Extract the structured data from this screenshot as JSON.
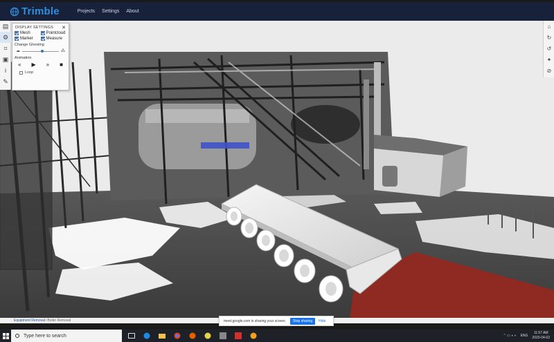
{
  "app": {
    "brand": "Trimble",
    "nav": [
      "Projects",
      "Settings",
      "About"
    ]
  },
  "display_settings": {
    "title": "DISPLAY SETTINGS",
    "close": "✕",
    "checkboxes": [
      {
        "label": "Mesh",
        "checked": true
      },
      {
        "label": "Pointcloud",
        "checked": true
      },
      {
        "label": "Marker",
        "checked": true
      },
      {
        "label": "Measure",
        "checked": true
      }
    ],
    "change_ghosting_label": "Change Ghosting",
    "ghosting_level": 0.55,
    "animation_label": "Animation",
    "animation_controls": [
      "«",
      "▶",
      "»",
      "■"
    ],
    "loop_label": "Loop"
  },
  "left_toolbar": [
    "book-icon",
    "gear-icon",
    "crop-icon",
    "folder-icon",
    "info-icon",
    "ruler-icon",
    "help-icon"
  ],
  "left_toolbar_glyphs": [
    "▤",
    "⚙",
    "⌗",
    "▣",
    "i",
    "✎",
    "?"
  ],
  "right_toolbar": [
    "home-icon",
    "refresh-icon",
    "undo-icon",
    "walk-icon",
    "compass-icon"
  ],
  "right_toolbar_glyphs": [
    "⌂",
    "↻",
    "↺",
    "✦",
    "⊘"
  ],
  "breadcrumb": {
    "items": [
      "Equipment Removal"
    ],
    "current": "Boiler Removal",
    "separator": "/"
  },
  "screen_share": {
    "message": "meet.google.com is sharing your screen.",
    "stop_label": "Stop sharing",
    "hide_label": "Hide"
  },
  "taskbar": {
    "search_placeholder": "Type here to search",
    "language": "ENG",
    "time": "11:57 AM",
    "date": "2020-04-02"
  },
  "colors": {
    "appbar": "#17213a",
    "brand": "#2f8fdc",
    "accent": "#3a6fb8",
    "red_zone": "#8e2a22"
  }
}
